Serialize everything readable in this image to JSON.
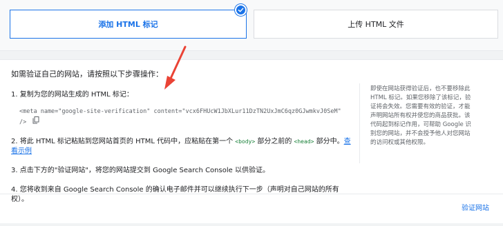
{
  "tabs": {
    "option1": "添加 HTML 标记",
    "option2": "上传 HTML 文件"
  },
  "instructions": {
    "intro": "如需验证自己的网站，请按照以下步骤操作：",
    "step1": "1. 复制为您的网站生成的 HTML 标记：",
    "code_line1": "<meta name=\"google-site-verification\" content=\"vcx6FHUcW1JbXLur11DzTN2UxJmC6qz0GJwmkvJ0SeM\"",
    "code_line2": "/>",
    "step2_a": "2. 将此 HTML 标记粘贴到您网站首页的 HTML 代码中，应粘贴在第一个 ",
    "step2_tag1": "<body>",
    "step2_b": " 部分之前的 ",
    "step2_tag2": "<head>",
    "step2_c": " 部分中。",
    "step2_link": "查看示例",
    "step3": "3. 点击下方的\"验证网站\"，将您的网站提交到 Google Search Console 以供验证。",
    "step4": "4. 您将收到来自 Google Search Console 的确认电子邮件并可以继续执行下一步（声明对自己网站的所有权）。"
  },
  "note": "即使在网站获得验证后，也不要移除此 HTML 标记。如果您移除了该标记，验证将会失效。您需要有效的验证，才能声明网站所有权并使您的商品获批。该代码起到标记作用，可帮助 Google 识别您的网站，并不会授予他人对您网站的访问权或其他权限。",
  "footer": {
    "verify_label": "验证网站"
  },
  "colors": {
    "accent": "#1a73e8",
    "arrow": "#ea4335",
    "tag_green": "#188038"
  }
}
